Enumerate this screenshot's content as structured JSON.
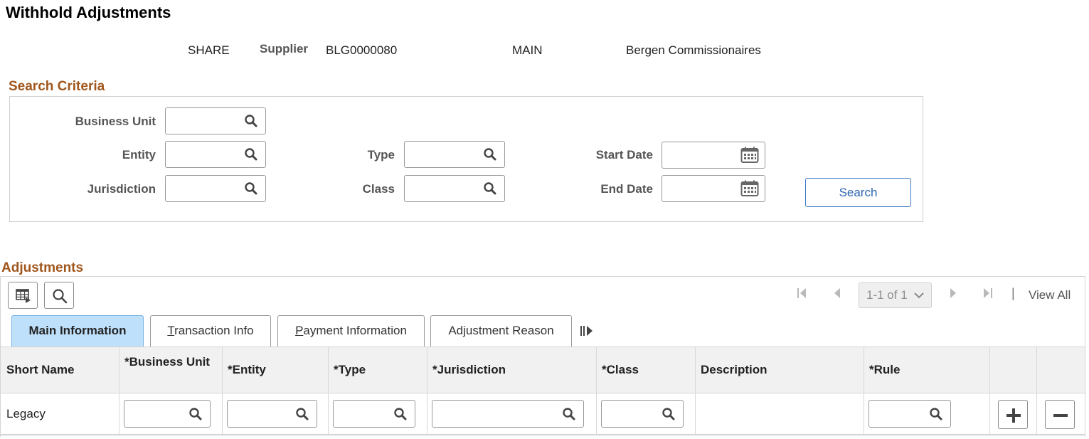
{
  "page": {
    "title": "Withhold Adjustments"
  },
  "header": {
    "setid": "SHARE",
    "supplier_label": "Supplier",
    "supplier_id": "BLG0000080",
    "location": "MAIN",
    "supplier_name": "Bergen Commissionaires"
  },
  "search_criteria": {
    "title": "Search Criteria",
    "business_unit_label": "Business Unit",
    "entity_label": "Entity",
    "jurisdiction_label": "Jurisdiction",
    "type_label": "Type",
    "class_label": "Class",
    "start_date_label": "Start Date",
    "end_date_label": "End Date",
    "business_unit_value": "",
    "entity_value": "",
    "jurisdiction_value": "",
    "type_value": "",
    "class_value": "",
    "start_date_value": "",
    "end_date_value": "",
    "search_button": "Search"
  },
  "adjustments": {
    "title": "Adjustments",
    "pager": {
      "range": "1-1 of 1",
      "view_all": "View All",
      "separator": "|"
    },
    "tabs": [
      {
        "label": "Main Information",
        "active": true
      },
      {
        "label": "Transaction Info",
        "mnemonic": "T"
      },
      {
        "label": "Payment Information",
        "mnemonic": "P"
      },
      {
        "label": "Adjustment Reason",
        "mnemonic": "j"
      }
    ],
    "columns": [
      "Short Name",
      "*Business Unit",
      "*Entity",
      "*Type",
      "*Jurisdiction",
      "*Class",
      "Description",
      "*Rule"
    ],
    "rows": [
      {
        "short_name": "Legacy",
        "business_unit": "",
        "entity": "",
        "type": "",
        "jurisdiction": "",
        "class": "",
        "description": "",
        "rule": ""
      }
    ]
  },
  "icons": {
    "field_lookup": "search-icon",
    "date_picker": "calendar-icon",
    "personalize": "grid-settings-icon",
    "find": "search-icon",
    "first": "first-page-icon",
    "previous": "previous-page-icon",
    "next": "next-page-icon",
    "last": "last-page-icon",
    "show_all_columns": "show-all-columns-icon",
    "add_row": "plus-icon",
    "delete_row": "minus-icon"
  },
  "colors": {
    "section_title": "#a0561c",
    "active_tab": "#bfe0fb",
    "search_button_border": "#3b79c4"
  }
}
